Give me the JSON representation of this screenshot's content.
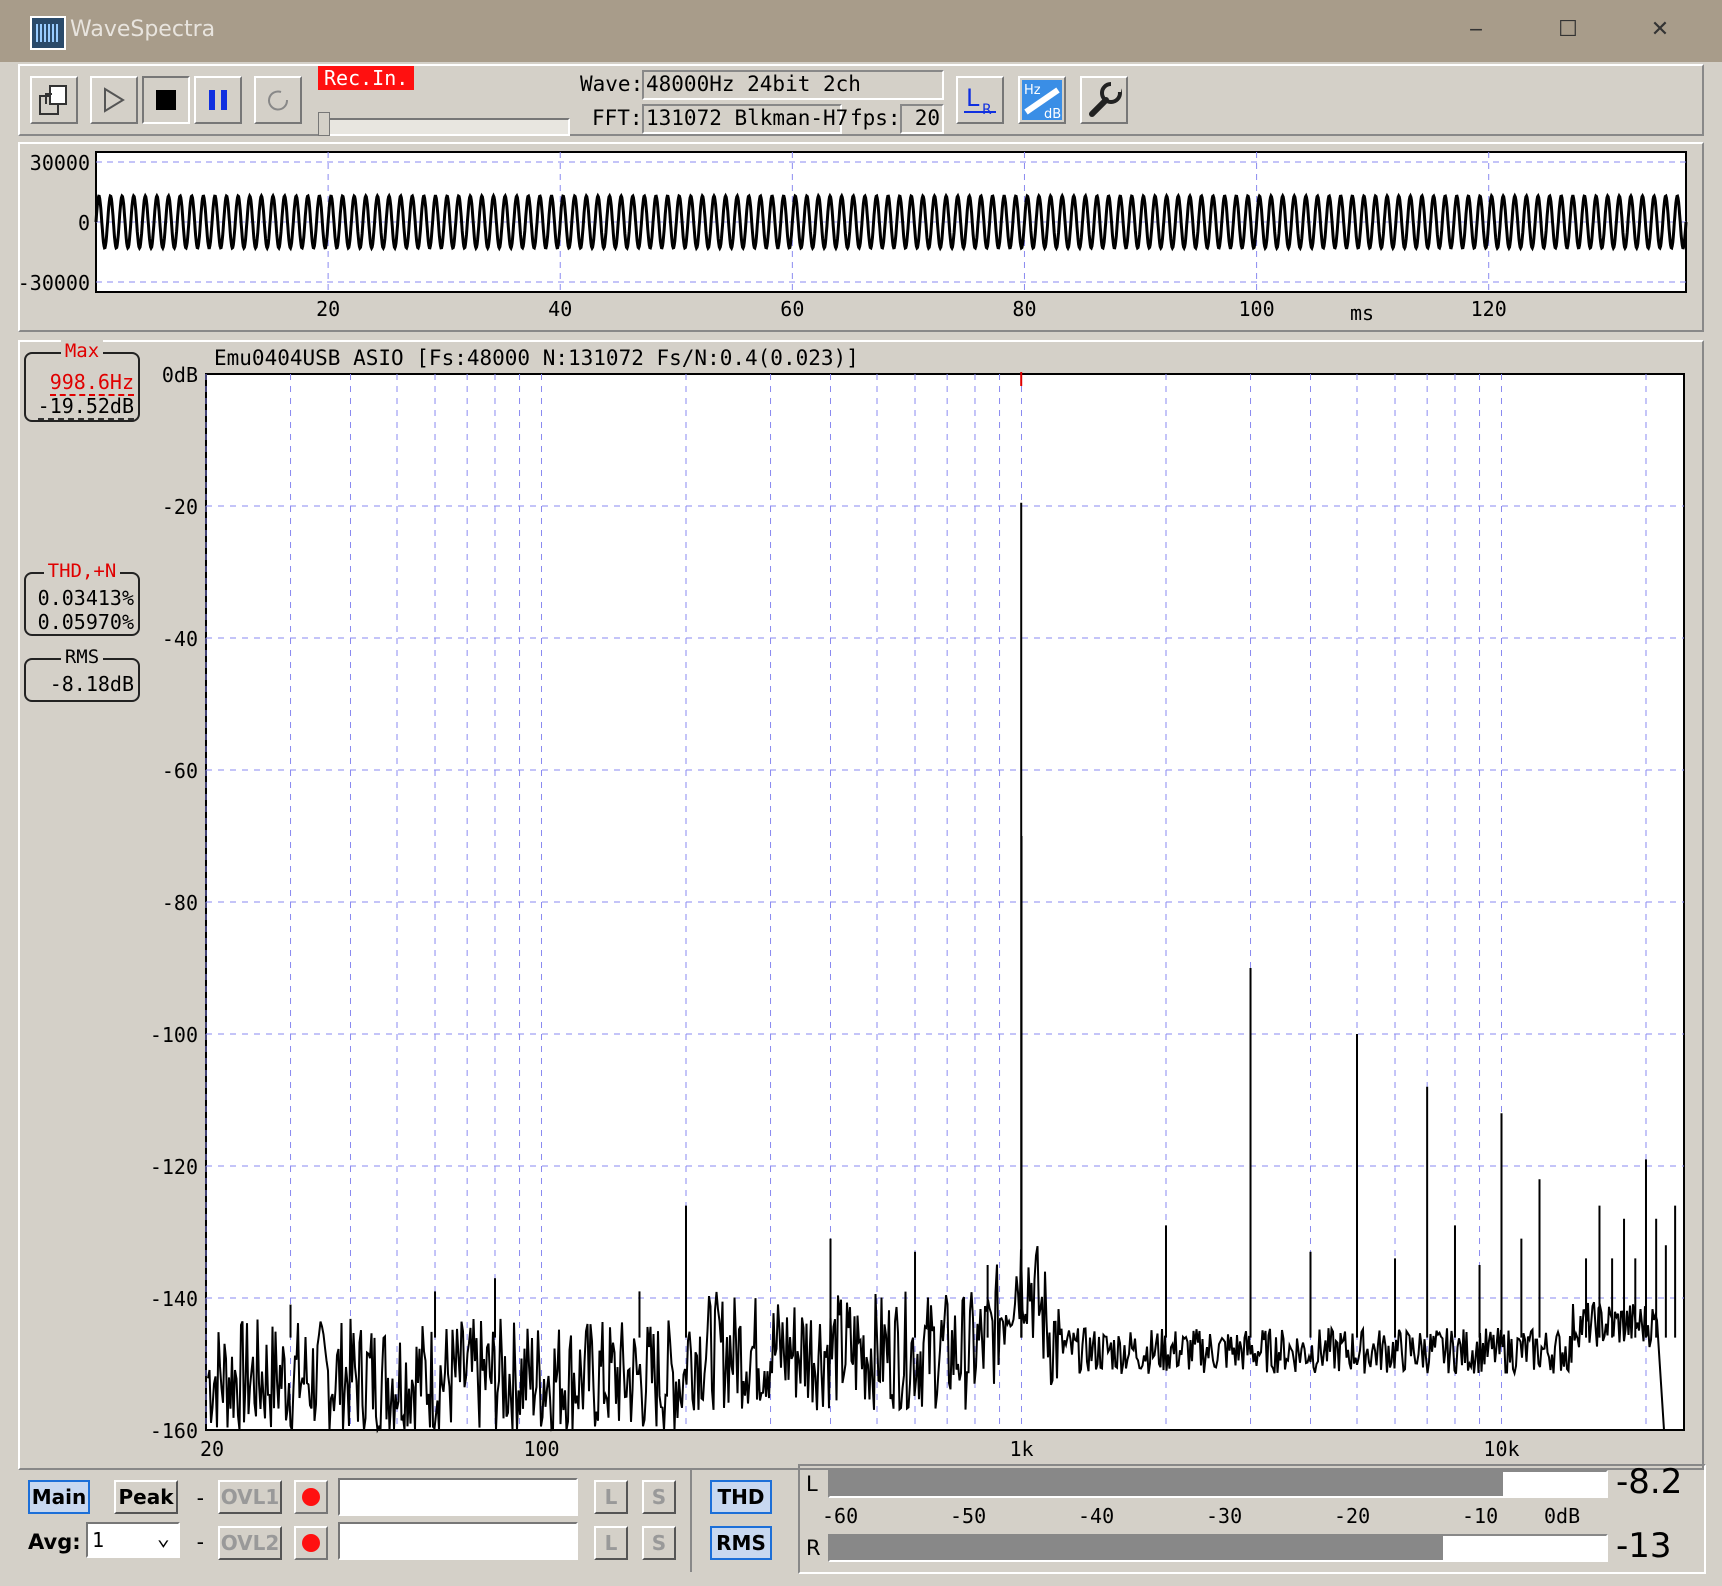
{
  "window": {
    "title": "WaveSpectra",
    "minimize": "‒",
    "maximize": "☐",
    "close": "✕"
  },
  "toolbar": {
    "rec_in": "Rec.In.",
    "wave_label": "Wave:",
    "wave_value": "48000Hz 24bit 2ch",
    "fft_label": "FFT:",
    "fft_value": "131072 Blkman-H7",
    "fps_label": "fps:",
    "fps_value": "20",
    "icons": [
      "open-file-icon",
      "play-icon",
      "stop-icon",
      "pause-icon",
      "refresh-icon",
      "lr-channel-icon",
      "hz-db-scale-icon",
      "settings-wrench-icon"
    ],
    "lr_label_l": "L",
    "lr_label_r": "R",
    "hzdb_hz": "Hz",
    "hzdb_db": "dB"
  },
  "waveform": {
    "y_ticks": [
      "30000",
      "0",
      "-30000"
    ],
    "x_ticks": [
      "20",
      "40",
      "60",
      "80",
      "100",
      "120"
    ],
    "x_unit": "ms"
  },
  "spectrum": {
    "header": "Emu0404USB ASIO  [Fs:48000 N:131072 Fs/N:0.4(0.023)]",
    "y_ticks": [
      "0dB",
      "-20",
      "-40",
      "-60",
      "-80",
      "-100",
      "-120",
      "-140",
      "-160"
    ],
    "x_ticks": [
      "20",
      "100",
      "1k",
      "10k"
    ],
    "max_box": {
      "title": "Max",
      "freq": "998.6Hz",
      "level": "-19.52dB"
    },
    "thd_box": {
      "title": "THD,+N",
      "thd": "0.03413%",
      "thdn": "0.05970%"
    },
    "rms_box": {
      "title": "RMS",
      "value": "-8.18dB"
    }
  },
  "chart_data": {
    "type": "line",
    "title": "Emu0404USB ASIO  [Fs:48000 N:131072 Fs/N:0.4(0.023)]",
    "xlabel": "",
    "ylabel": "",
    "x_scale": "log",
    "xlim": [
      20,
      24000
    ],
    "ylim": [
      -160,
      0
    ],
    "series": [
      {
        "name": "",
        "peaks": [
          {
            "x": 30,
            "y": -141
          },
          {
            "x": 60,
            "y": -139
          },
          {
            "x": 80,
            "y": -137
          },
          {
            "x": 160,
            "y": -139
          },
          {
            "x": 200,
            "y": -126
          },
          {
            "x": 400,
            "y": -131
          },
          {
            "x": 600,
            "y": -133
          },
          {
            "x": 850,
            "y": -135
          },
          {
            "x": 998.6,
            "y": -19.5
          },
          {
            "x": 1000,
            "y": -70
          },
          {
            "x": 2000,
            "y": -129
          },
          {
            "x": 3000,
            "y": -90
          },
          {
            "x": 4000,
            "y": -133
          },
          {
            "x": 5000,
            "y": -100
          },
          {
            "x": 6000,
            "y": -134
          },
          {
            "x": 7000,
            "y": -108
          },
          {
            "x": 8000,
            "y": -129
          },
          {
            "x": 9000,
            "y": -135
          },
          {
            "x": 10000,
            "y": -112
          },
          {
            "x": 11000,
            "y": -131
          },
          {
            "x": 12000,
            "y": -122
          },
          {
            "x": 15000,
            "y": -134
          },
          {
            "x": 16000,
            "y": -126
          },
          {
            "x": 17000,
            "y": -134
          },
          {
            "x": 18000,
            "y": -128
          },
          {
            "x": 19000,
            "y": -134
          },
          {
            "x": 20000,
            "y": -119
          },
          {
            "x": 21000,
            "y": -128
          },
          {
            "x": 22000,
            "y": -132
          },
          {
            "x": 23000,
            "y": -126
          }
        ],
        "noise_floor_db": -148
      }
    ]
  },
  "bottom": {
    "main_btn": "Main",
    "peak_btn": "Peak",
    "avg_label": "Avg:",
    "avg_value": "1",
    "dash1": "-",
    "dash2": "-",
    "ovl1": "OVL1",
    "ovl2": "OVL2",
    "l": "L",
    "s": "S",
    "thd_btn": "THD",
    "rms_btn": "RMS"
  },
  "meter": {
    "l_label": "L",
    "r_label": "R",
    "scale": [
      "-60",
      "-50",
      "-40",
      "-30",
      "-20",
      "-10",
      "0dB"
    ],
    "l_value": "-8.2",
    "r_value": "-13",
    "l_level_db": -8.2,
    "r_level_db": -13
  }
}
